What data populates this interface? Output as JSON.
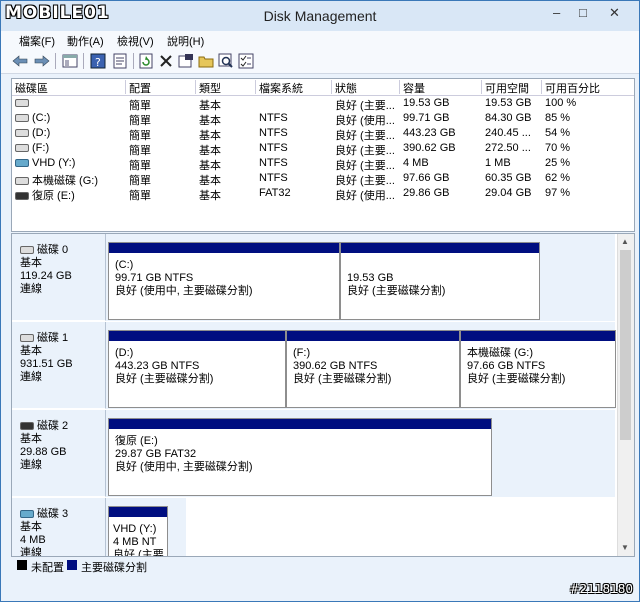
{
  "watermark_logo": "MOBILE01",
  "window": {
    "title": "Disk Management",
    "minimize": "–",
    "maximize": "□",
    "close": "✕"
  },
  "menu": [
    "檔案(F)",
    "動作(A)",
    "檢視(V)",
    "說明(H)"
  ],
  "toolbar": [
    "back-icon",
    "forward-icon",
    "console-icon",
    "help-icon",
    "properties-icon",
    "refresh-icon",
    "delete-icon",
    "settings-icon",
    "folder-open-icon",
    "magnify-icon",
    "checklist-icon"
  ],
  "volumes": {
    "headers": [
      "磁碟區",
      "配置",
      "類型",
      "檔案系統",
      "狀態",
      "容量",
      "可用空間",
      "可用百分比"
    ],
    "rows": [
      {
        "name": "",
        "layout": "簡單",
        "type": "基本",
        "fs": "",
        "status": "良好 (主要...",
        "capacity": "19.53 GB",
        "free": "19.53 GB",
        "pct": "100 %",
        "icon": "disk"
      },
      {
        "name": "(C:)",
        "layout": "簡單",
        "type": "基本",
        "fs": "NTFS",
        "status": "良好 (使用...",
        "capacity": "99.71 GB",
        "free": "84.30 GB",
        "pct": "85 %",
        "icon": "disk"
      },
      {
        "name": "(D:)",
        "layout": "簡單",
        "type": "基本",
        "fs": "NTFS",
        "status": "良好 (主要...",
        "capacity": "443.23 GB",
        "free": "240.45 ...",
        "pct": "54 %",
        "icon": "disk"
      },
      {
        "name": "(F:)",
        "layout": "簡單",
        "type": "基本",
        "fs": "NTFS",
        "status": "良好 (主要...",
        "capacity": "390.62 GB",
        "free": "272.50 ...",
        "pct": "70 %",
        "icon": "disk"
      },
      {
        "name": "VHD (Y:)",
        "layout": "簡單",
        "type": "基本",
        "fs": "NTFS",
        "status": "良好 (主要...",
        "capacity": "4 MB",
        "free": "1 MB",
        "pct": "25 %",
        "icon": "vhd"
      },
      {
        "name": "本機磁碟 (G:)",
        "layout": "簡單",
        "type": "基本",
        "fs": "NTFS",
        "status": "良好 (主要...",
        "capacity": "97.66 GB",
        "free": "60.35 GB",
        "pct": "62 %",
        "icon": "disk"
      },
      {
        "name": "復原 (E:)",
        "layout": "簡單",
        "type": "基本",
        "fs": "FAT32",
        "status": "良好 (使用...",
        "capacity": "29.86 GB",
        "free": "29.04 GB",
        "pct": "97 %",
        "icon": "rec"
      }
    ]
  },
  "disks": [
    {
      "name": "磁碟 0",
      "type": "基本",
      "size": "119.24 GB",
      "state": "連線",
      "partitions": [
        {
          "label": "(C:)",
          "size": "99.71 GB NTFS",
          "status": "良好 (使用中, 主要磁碟分割)"
        },
        {
          "label": "",
          "size": "19.53 GB",
          "status": "良好 (主要磁碟分割)"
        }
      ]
    },
    {
      "name": "磁碟 1",
      "type": "基本",
      "size": "931.51 GB",
      "state": "連線",
      "partitions": [
        {
          "label": "(D:)",
          "size": "443.23 GB NTFS",
          "status": "良好 (主要磁碟分割)"
        },
        {
          "label": "(F:)",
          "size": "390.62 GB NTFS",
          "status": "良好 (主要磁碟分割)"
        },
        {
          "label": "本機磁碟 (G:)",
          "size": "97.66 GB NTFS",
          "status": "良好 (主要磁碟分割)"
        }
      ]
    },
    {
      "name": "磁碟 2",
      "type": "基本",
      "size": "29.88 GB",
      "state": "連線",
      "partitions": [
        {
          "label": "復原 (E:)",
          "size": "29.87 GB FAT32",
          "status": "良好 (使用中, 主要磁碟分割)"
        }
      ]
    },
    {
      "name": "磁碟 3",
      "type": "基本",
      "size": "4 MB",
      "state": "連線",
      "partitions": [
        {
          "label": "VHD (Y:)",
          "size": "4 MB NT",
          "status": "良好 (主要"
        }
      ]
    }
  ],
  "legend": [
    {
      "label": "未配置",
      "color": "#000000"
    },
    {
      "label": "主要磁碟分割",
      "color": "#000e80"
    }
  ],
  "footer_watermark": "#2118180"
}
